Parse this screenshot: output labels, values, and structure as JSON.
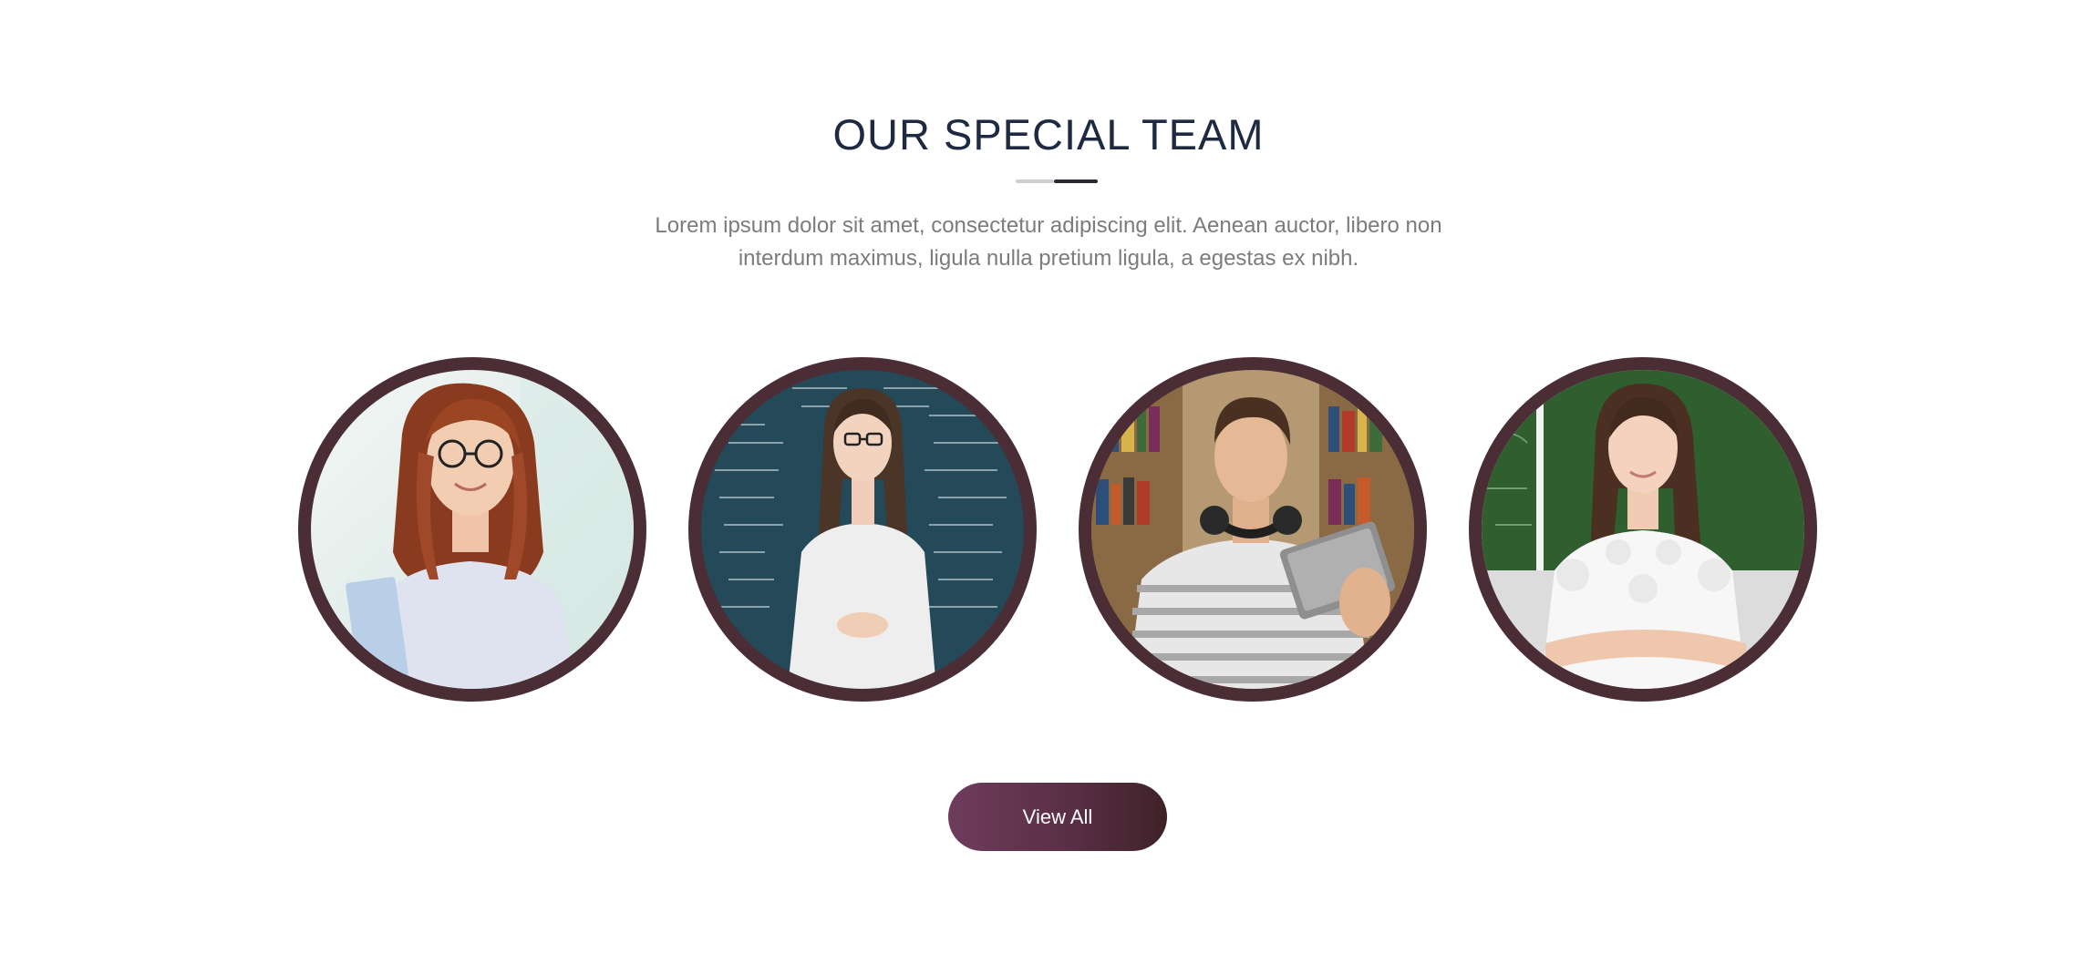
{
  "section": {
    "title": "OUR SPECIAL TEAM",
    "description": "Lorem ipsum dolor sit amet, consectetur adipiscing elit. Aenean auctor, libero non interdum maximus, ligula nulla pretium ligula, a egestas ex nibh."
  },
  "team": {
    "members": [
      {
        "icon": "team-member-1-photo"
      },
      {
        "icon": "team-member-2-photo"
      },
      {
        "icon": "team-member-3-photo"
      },
      {
        "icon": "team-member-4-photo"
      }
    ]
  },
  "view_all": {
    "label": "View All"
  },
  "colors": {
    "title": "#1d2a42",
    "frame": "#4a2d35",
    "button_start": "#6e3c5c",
    "button_end": "#3e2228",
    "body_text": "#7c7c7c"
  }
}
